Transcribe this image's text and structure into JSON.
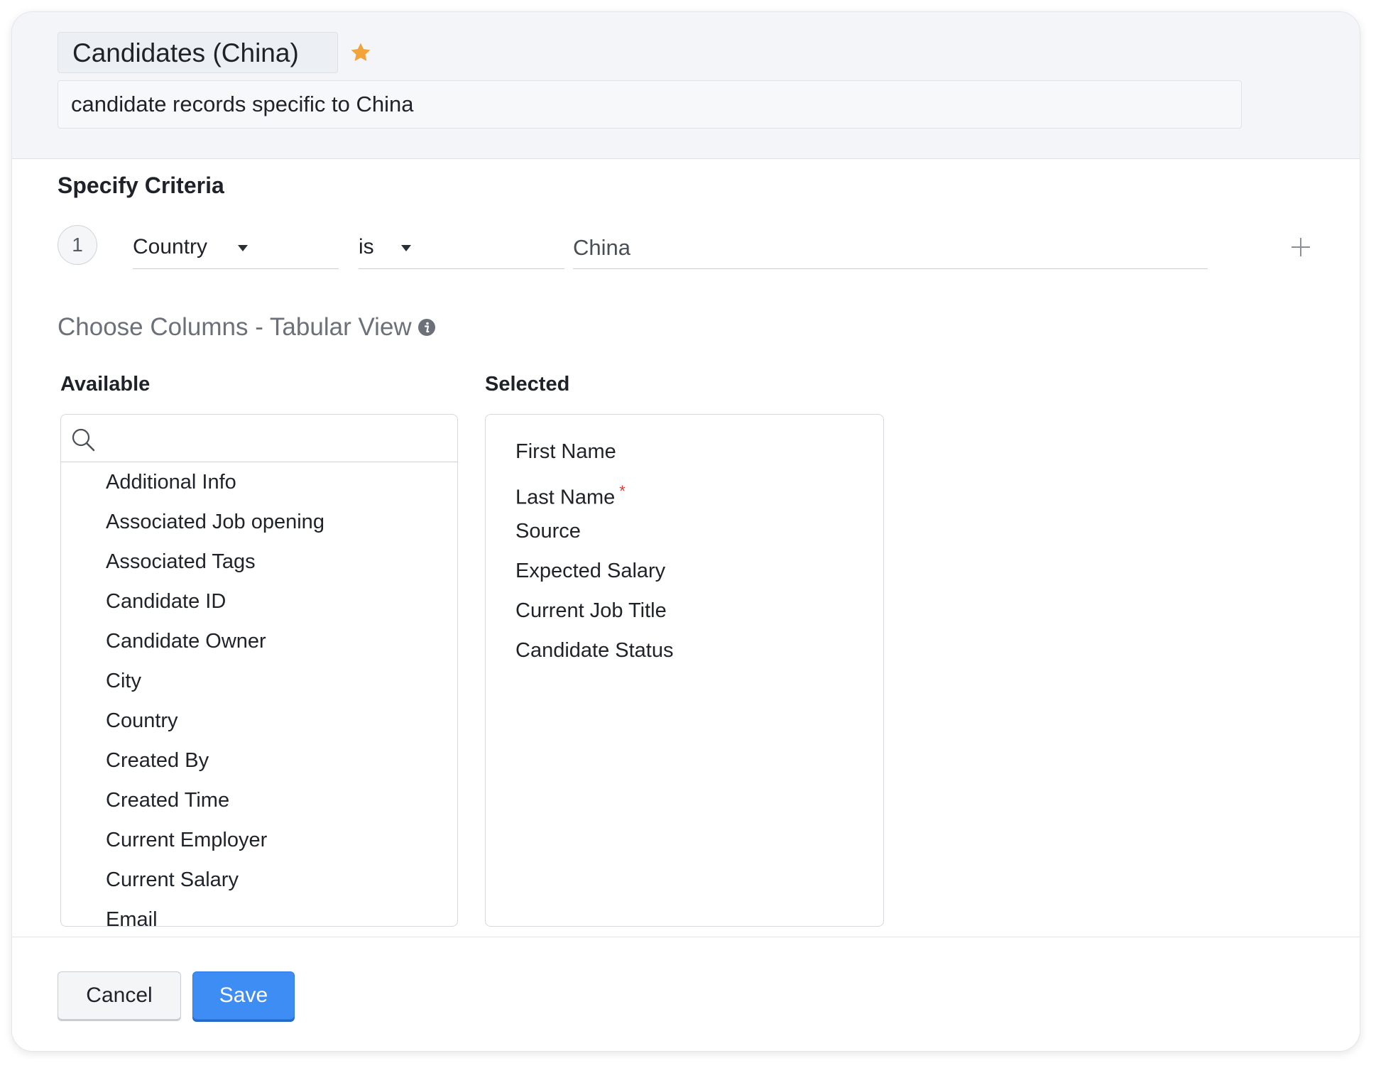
{
  "view": {
    "name": "Candidates (China)",
    "description": "candidate records specific to China",
    "accent_color": "#f2a33a"
  },
  "criteria": {
    "title": "Specify Criteria",
    "rows": [
      {
        "index": "1",
        "field": "Country",
        "operator": "is",
        "value": "China"
      }
    ]
  },
  "columns": {
    "title": "Choose Columns - Tabular View",
    "available_label": "Available",
    "selected_label": "Selected",
    "search_placeholder": "",
    "available": [
      "Additional Info",
      "Associated Job opening",
      "Associated Tags",
      "Candidate ID",
      "Candidate Owner",
      "City",
      "Country",
      "Created By",
      "Created Time",
      "Current Employer",
      "Current Salary",
      "Email"
    ],
    "selected": [
      "First Name",
      "Last Name",
      "Source",
      "Expected Salary",
      "Current Job Title",
      "Candidate Status"
    ],
    "required_marker": "*"
  },
  "footer": {
    "cancel_label": "Cancel",
    "save_label": "Save",
    "save_color": "#3d8df5"
  }
}
